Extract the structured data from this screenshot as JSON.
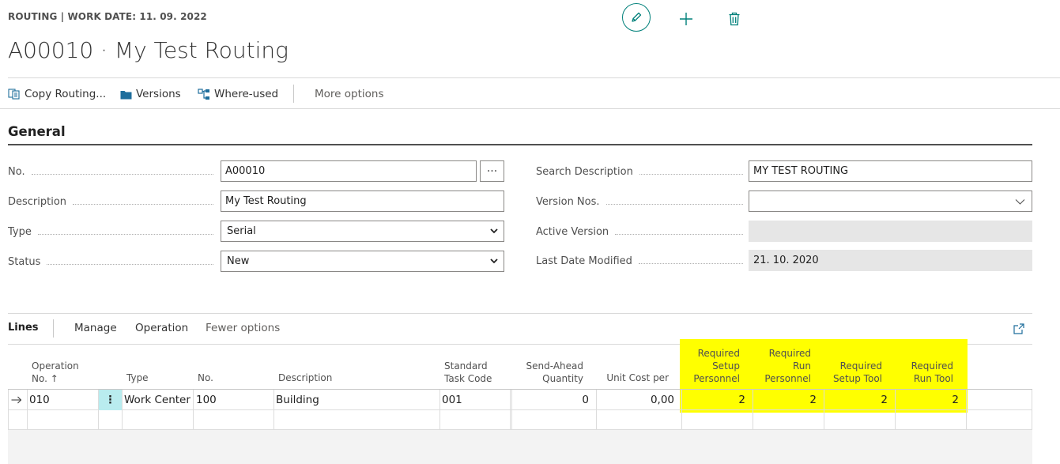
{
  "header": {
    "breadcrumb": "ROUTING | WORK DATE: 11. 09. 2022",
    "title": "A00010 · My Test Routing",
    "icons": [
      "edit-icon",
      "add-icon",
      "delete-icon"
    ]
  },
  "actions": {
    "copy_routing": "Copy Routing...",
    "versions": "Versions",
    "where_used": "Where-used",
    "more_options": "More options"
  },
  "general": {
    "title": "General",
    "left": [
      {
        "label": "No.",
        "value": "A00010"
      },
      {
        "label": "Description",
        "value": "My Test Routing"
      },
      {
        "label": "Type",
        "value": "Serial"
      },
      {
        "label": "Status",
        "value": "New"
      }
    ],
    "right": [
      {
        "label": "Search Description",
        "value": "MY TEST ROUTING"
      },
      {
        "label": "Version Nos.",
        "value": ""
      },
      {
        "label": "Active Version",
        "value": ""
      },
      {
        "label": "Last Date Modified",
        "value": "21. 10. 2020"
      }
    ],
    "assist_label": "···"
  },
  "lines": {
    "title": "Lines",
    "manage": "Manage",
    "operation": "Operation",
    "fewer_options": "Fewer options",
    "columns": {
      "operation_no_1": "Operation",
      "operation_no_2": "No. ↑",
      "type": "Type",
      "no": "No.",
      "description": "Description",
      "std_task_1": "Standard",
      "std_task_2": "Task Code",
      "send_ahead_1": "Send-Ahead",
      "send_ahead_2": "Quantity",
      "unit_cost": "Unit Cost per",
      "req_setup_pers_1": "Required",
      "req_setup_pers_2": "Setup",
      "req_setup_pers_3": "Personnel",
      "req_run_pers_1": "Required",
      "req_run_pers_2": "Run",
      "req_run_pers_3": "Personnel",
      "req_setup_tool_1": "Required",
      "req_setup_tool_2": "Setup Tool",
      "req_run_tool_1": "Required",
      "req_run_tool_2": "Run Tool"
    },
    "row": {
      "operation_no": "010",
      "menu": "⋮",
      "type": "Work Center",
      "no": "100",
      "description": "Building",
      "std_task": "001",
      "send_ahead": "0",
      "unit_cost": "0,00",
      "req_setup_pers": "2",
      "req_run_pers": "2",
      "req_setup_tool": "2",
      "req_run_tool": "2"
    }
  },
  "colors": {
    "accent": "#00807a",
    "highlight": "#ffff00"
  }
}
